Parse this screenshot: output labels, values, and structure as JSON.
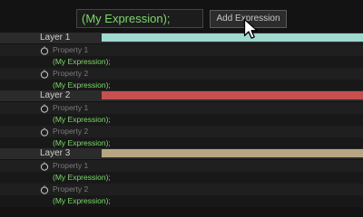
{
  "toolbar": {
    "expression_value": "(My Expression);",
    "add_button_label": "Add Expression"
  },
  "layers": [
    {
      "name": "Layer 1",
      "color": "#9fdad1",
      "properties": [
        {
          "label": "Property 1",
          "expression": "(My Expression);"
        },
        {
          "label": "Property 2",
          "expression": "(My Expression);"
        }
      ]
    },
    {
      "name": "Layer 2",
      "color": "#c6504f",
      "properties": [
        {
          "label": "Property 1",
          "expression": "(My Expression);"
        },
        {
          "label": "Property 2",
          "expression": "(My Expression);"
        }
      ]
    },
    {
      "name": "Layer 3",
      "color": "#b8a682",
      "properties": [
        {
          "label": "Property 1",
          "expression": "(My Expression);"
        },
        {
          "label": "Property 2",
          "expression": "(My Expression);"
        }
      ]
    }
  ],
  "icons": {
    "property": "stopwatch-icon",
    "pointer": "cursor-icon"
  }
}
